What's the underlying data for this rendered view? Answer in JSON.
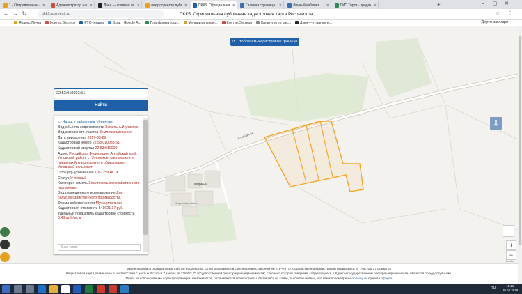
{
  "browser": {
    "tabs": [
      {
        "title": "1 - Отправленные - Я...",
        "color": "#e3a21a"
      },
      {
        "title": "Администратор начал...",
        "color": "#d54b3d"
      },
      {
        "title": "Дзен — главная новост...",
        "color": "#222222"
      },
      {
        "title": "лик росреестр публичн...",
        "color": "#e3a21a"
      },
      {
        "title": "ПКК5: Официальная...",
        "color": "#1d5fa9"
      },
      {
        "title": "Главная страница",
        "color": "#3a6fb0"
      },
      {
        "title": "Личный кабинет",
        "color": "#3a6fb0"
      },
      {
        "title": "ГИС Торги - продажи...",
        "color": "#2e8b57"
      }
    ],
    "active_tab": 4,
    "url": "pkk5.rosreestr.ru",
    "page_title": "ПКК5: Официальная публичная кадастровая карта Росреестра",
    "bookmarks": [
      {
        "label": "Яндекс.Почта",
        "color": "#e3a21a"
      },
      {
        "label": "Контур.Экстерн",
        "color": "#d54b3d"
      },
      {
        "label": "РТС-тендер",
        "color": "#1d5fa9"
      },
      {
        "label": "Вход - Google A...",
        "color": "#4285f4"
      },
      {
        "label": "Платформа госу...",
        "color": "#2e8b57"
      },
      {
        "label": "Муниципальные...",
        "color": "#c7a23a"
      },
      {
        "label": "Контур.Экстерн",
        "color": "#d54b3d"
      },
      {
        "label": "Калькулятор рас...",
        "color": "#888888"
      },
      {
        "label": "Дзен — главная н...",
        "color": "#222222"
      }
    ],
    "other_bookmarks": "Другие закладки"
  },
  "map": {
    "toggle_button": "Отобразить кадастровые границы",
    "search_value": "22:53:010033:51",
    "find_button": "Найти",
    "labels": {
      "village": "Мирный",
      "road": "Степная ул.",
      "school": "Мирновская школа"
    },
    "parcel_color": "#f5a623",
    "details": {
      "back": "← Назад к найденным объектам",
      "rows": [
        {
          "label": "Вид объекта недвижимости",
          "value": "Земельный участок"
        },
        {
          "label": "Вид земельного участка",
          "value": "Землепользование"
        },
        {
          "label": "Дата присвоения",
          "value": "2017-03-29"
        },
        {
          "label": "Кадастровый номер",
          "value": "22:53:010033:51"
        },
        {
          "label": "Кадастровый квартал",
          "value": "22:53:010000"
        },
        {
          "label": "Адрес",
          "value": "Российская Федерация, Алтайский край, Угловский район, с. Угловское, расположен в пределах Муниципального образования Угловский сельсовет"
        },
        {
          "label": "Площадь уточненная",
          "value": "1057259 кв. м"
        },
        {
          "label": "Статус",
          "value": "Учтенный"
        },
        {
          "label": "Категория земель",
          "value": "Земли сельскохозяйственного назначения"
        },
        {
          "label": "Вид разрешенного использования",
          "value": "Для сельскохозяйственного производства"
        },
        {
          "label": "Форма собственности",
          "value": "Муниципальная"
        },
        {
          "label": "Кадастровая стоимость",
          "value": "541621.37 руб."
        },
        {
          "label": "Удельный показатель кадастровой стоимости",
          "value": "0.43 руб./кв. м"
        }
      ],
      "email_placeholder": "Ваш email"
    },
    "attribution": "Leaflet"
  },
  "footer": {
    "line1": "Мы не являемся официальным сайтом Росреестра. Отчеты выдаются в соответствии с законом № 218-ФЗ \"О государственной регистрации недвижимости\", частью 27 статьи 62",
    "line2": "Кадастровая карта размещена в соответствии с частью 3 статьи 7 закона № 218-ФЗ \"О государственной регистрации недвижимости\", согласно которой сведения, содержащиеся в Едином государственном реестре недвижимости, являются общедоступными.",
    "line3_a": "Плата за использование кадастровой карты не взимается, оплачиваются только отчеты. Оставаясь на сайте, вы соглашаетесь, что вами просмотрены",
    "line3_link1": "образцы",
    "line3_b": "и принята",
    "line3_link2": "оферта"
  },
  "taskbar": {
    "lang": "RU",
    "time": "15:22",
    "date": "29.04.2026"
  }
}
